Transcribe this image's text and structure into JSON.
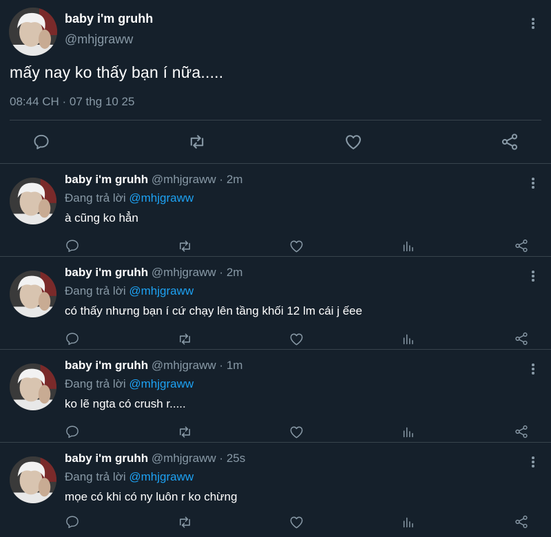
{
  "main_tweet": {
    "display_name": "baby i'm gruhh",
    "handle": "@mhjgraww",
    "text": "mấy nay ko thấy bạn í nữa.....",
    "timestamp": "08:44 CH · 07 thg 10 25",
    "actions": [
      "reply-icon",
      "retweet-icon",
      "like-icon",
      "share-icon"
    ]
  },
  "replies": [
    {
      "display_name": "baby i'm gruhh",
      "handle": "@mhjgraww",
      "time": "2m",
      "replying_prefix": "Đang trả lời",
      "replying_to": "@mhjgraww",
      "text": "à cũng ko hẳn"
    },
    {
      "display_name": "baby i'm gruhh",
      "handle": "@mhjgraww",
      "time": "2m",
      "replying_prefix": "Đang trả lời",
      "replying_to": "@mhjgraww",
      "text": "có thấy nhưng bạn í cứ chạy lên tầng khối 12 lm cái j ếee"
    },
    {
      "display_name": "baby i'm gruhh",
      "handle": "@mhjgraww",
      "time": "1m",
      "replying_prefix": "Đang trả lời",
      "replying_to": "@mhjgraww",
      "text": "ko lẽ ngta có crush r....."
    },
    {
      "display_name": "baby i'm gruhh",
      "handle": "@mhjgraww",
      "time": "25s",
      "replying_prefix": "Đang trả lời",
      "replying_to": "@mhjgraww",
      "text": "mọe có khi có ny luôn r ko chừng"
    }
  ],
  "colors": {
    "background": "#15202b",
    "secondary_text": "#8899a6",
    "mention": "#1da1f2",
    "divider": "#38444d"
  }
}
